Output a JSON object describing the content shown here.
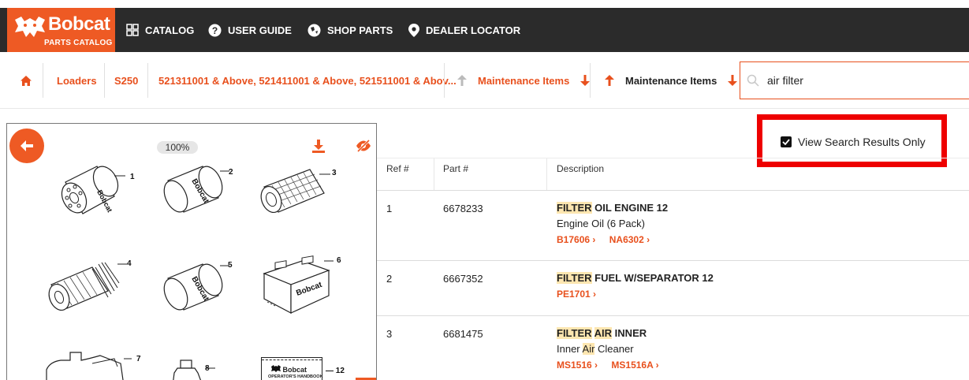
{
  "brand": {
    "name": "Bobcat",
    "subtitle": "PARTS CATALOG",
    "color": "#ee5a24"
  },
  "nav": [
    {
      "label": "CATALOG",
      "icon": "grid-icon"
    },
    {
      "label": "USER GUIDE",
      "icon": "question-icon"
    },
    {
      "label": "SHOP PARTS",
      "icon": "globe-icon"
    },
    {
      "label": "DEALER LOCATOR",
      "icon": "map-pin-icon"
    }
  ],
  "breadcrumb": {
    "home_icon": "home-icon",
    "items": [
      "Loaders",
      "S250",
      "521311001 & Above, 521411001 & Above, 521511001 & Abov...",
      "Maintenance Items",
      "Maintenance Items"
    ]
  },
  "search": {
    "value": "air filter",
    "placeholder": "Search"
  },
  "diagram": {
    "zoom": "100%",
    "labels": [
      "1",
      "2",
      "3",
      "4",
      "5",
      "6",
      "7",
      "8",
      "12"
    ],
    "handbook_brand": "Bobcat",
    "handbook_title": "OPERATOR'S HANDBOOK"
  },
  "view_search_results": {
    "label": "View Search Results Only",
    "checked": true
  },
  "table": {
    "headers": [
      "Ref #",
      "Part #",
      "Description"
    ],
    "rows": [
      {
        "ref": "1",
        "part": "6678233",
        "title_hl": "FILTER",
        "title_hl2": "",
        "title_rest": " OIL ENGINE 12",
        "sub_pre": "Engine Oil (6 Pack)",
        "sub_hl": "",
        "sub_post": "",
        "links": [
          "B17606",
          "NA6302"
        ]
      },
      {
        "ref": "2",
        "part": "6667352",
        "title_hl": "FILTER",
        "title_hl2": "",
        "title_rest": " FUEL W/SEPARATOR 12",
        "sub_pre": "",
        "sub_hl": "",
        "sub_post": "",
        "links": [
          "PE1701"
        ]
      },
      {
        "ref": "3",
        "part": "6681475",
        "title_hl": "FILTER",
        "title_hl2": "AIR",
        "title_rest": " INNER",
        "sub_pre": "Inner ",
        "sub_hl": "Air",
        "sub_post": " Cleaner",
        "links": [
          "MS1516",
          "MS1516A"
        ]
      }
    ]
  }
}
